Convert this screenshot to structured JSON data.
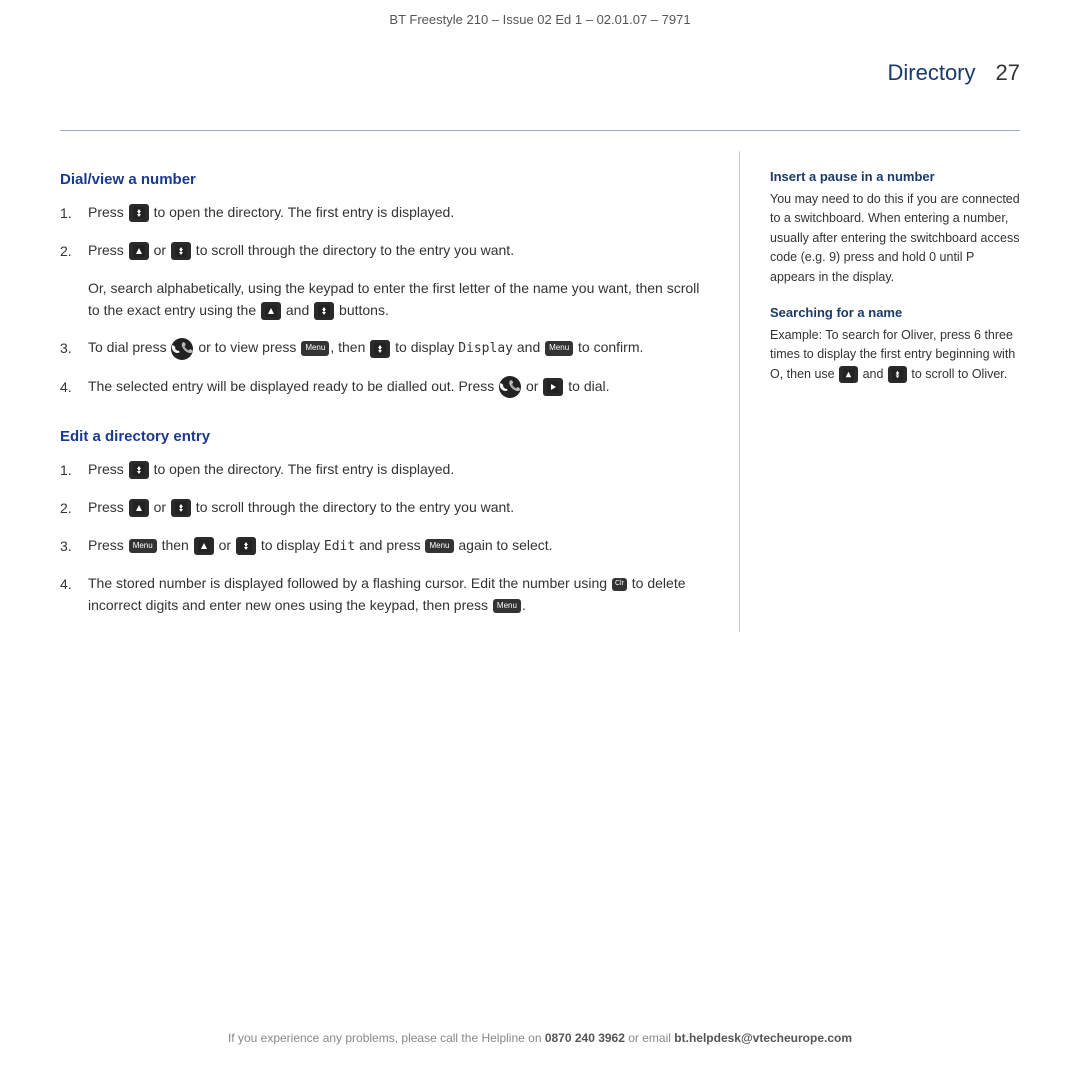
{
  "header": {
    "title": "BT Freestyle 210 – Issue 02 Ed 1 – 02.01.07 – 7971",
    "directory_label": "Directory",
    "page_number": "27"
  },
  "left": {
    "section1_title": "Dial/view a number",
    "items1": [
      {
        "num": "1.",
        "text": "Press [DIR] to open the directory. The first entry is displayed."
      },
      {
        "num": "2.",
        "text": "Press [UP] or [DIR] to scroll through the directory to the entry you want."
      },
      {
        "num": "3.",
        "text": "To dial press [PHONE] or to view press [MENU], then [DIR] to display [DISPLAY] and [MENU] to confirm."
      },
      {
        "num": "4.",
        "text": "The selected entry will be displayed ready to be dialled out. Press [PHONE] or [PLAY] to dial."
      }
    ],
    "extra_para": "Or, search alphabetically, using the keypad to enter the first letter of the name you want, then scroll to the exact entry using the [UP] and [DIR] buttons.",
    "display_code": "Display",
    "section2_title": "Edit a directory entry",
    "items2": [
      {
        "num": "1.",
        "text": "Press [DIR] to open the directory. The first entry is displayed."
      },
      {
        "num": "2.",
        "text": "Press [UP] or [DIR] to scroll through the directory to the entry you want."
      },
      {
        "num": "3.",
        "text": "Press [MENU] then [UP] or [DIR] to display [EDIT] and press [MENU] again to select."
      },
      {
        "num": "4.",
        "text": "The stored number is displayed followed by a flashing cursor. Edit the number using [CLR] to delete incorrect digits and enter new ones using the keypad, then press [MENU]."
      }
    ],
    "edit_code": "Edit"
  },
  "right": {
    "section1_title": "Insert a pause in a number",
    "section1_text": "You may need to do this if you are connected to a switchboard. When entering a number, usually after entering the switchboard access code (e.g. 9) press and hold 0 until P appears in the display.",
    "section2_title": "Searching for a name",
    "section2_text": "Example: To search for Oliver, press 6 three times to display the first entry beginning with O, then use [UP] and [DIR] to scroll to Oliver."
  },
  "footer": {
    "text_before": "If you experience any problems, please call the Helpline on ",
    "phone": "0870 240 3962",
    "text_mid": " or email ",
    "email": "bt.helpdesk@vtecheurope.com"
  }
}
